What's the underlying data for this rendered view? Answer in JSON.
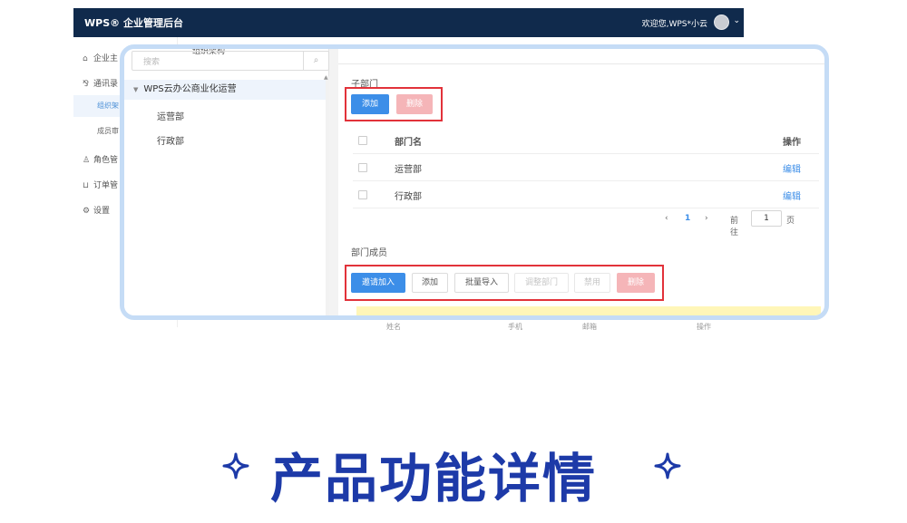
{
  "app": {
    "brand": "WPS® 企业管理后台",
    "welcome": "欢迎您,WPS*小云",
    "nav": [
      {
        "label": "企业主",
        "icon": "home-icon"
      },
      {
        "label": "通讯录",
        "icon": "contacts-icon"
      },
      {
        "label": "组织架",
        "icon": ""
      },
      {
        "label": "成员审",
        "icon": ""
      },
      {
        "label": "角色管",
        "icon": "user-icon"
      },
      {
        "label": "订单管",
        "icon": "cart-icon"
      },
      {
        "label": "设置",
        "icon": "settings-icon"
      }
    ]
  },
  "popup": {
    "clipped_label": "组织架构",
    "search_placeholder": "搜索",
    "tree": {
      "root": "WPS云办公商业化运营",
      "children": [
        "运营部",
        "行政部"
      ]
    },
    "sub_departments": {
      "title": "子部门",
      "add_label": "添加",
      "delete_label": "删除",
      "columns": {
        "name": "部门名",
        "action": "操作"
      },
      "rows": [
        {
          "name": "运营部",
          "action": "编辑"
        },
        {
          "name": "行政部",
          "action": "编辑"
        }
      ],
      "pager": {
        "prev": "‹",
        "current": "1",
        "next": "›",
        "goto_prefix": "前往",
        "goto_value": "1",
        "goto_suffix": "页"
      }
    },
    "members": {
      "title": "部门成员",
      "buttons": {
        "invite": "邀请加入",
        "add": "添加",
        "batch_import": "批量导入",
        "adjust_dept": "调整部门",
        "disable": "禁用",
        "delete": "删除"
      },
      "behind_columns": [
        "姓名",
        "手机",
        "邮箱",
        "操作"
      ]
    }
  },
  "headline": "产品功能详情",
  "colors": {
    "topbar": "#102a4c",
    "primary": "#3c8ee8",
    "highlight_box": "#e2323a",
    "headline": "#1d3aa8",
    "frame_border": "#c5dcf6"
  }
}
